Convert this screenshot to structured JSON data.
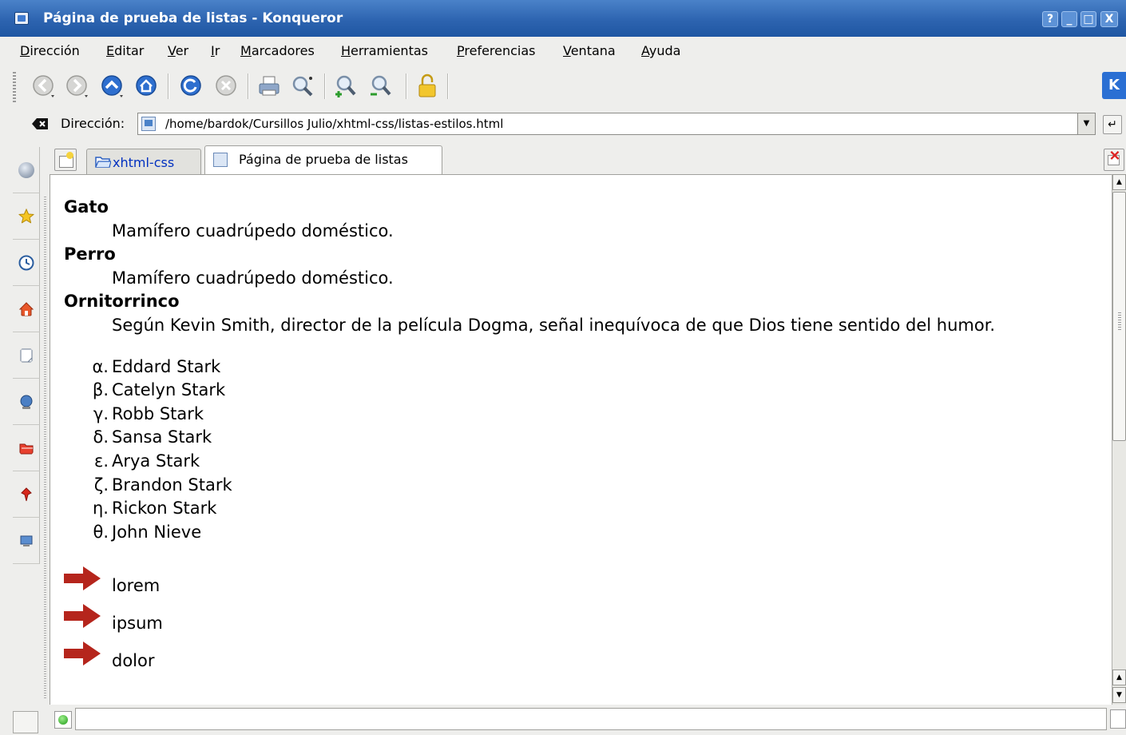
{
  "window": {
    "title": "Página de prueba de listas - Konqueror",
    "controls": [
      "?",
      "_",
      "□",
      "X"
    ]
  },
  "menubar": [
    "Dirección",
    "Editar",
    "Ver",
    "Ir",
    "Marcadores",
    "Herramientas",
    "Preferencias",
    "Ventana",
    "Ayuda"
  ],
  "toolbar": {
    "icons": [
      "back-icon",
      "forward-icon",
      "up-icon",
      "home-icon",
      "reload-icon",
      "stop-icon",
      "print-icon",
      "find-icon",
      "zoom-in-icon",
      "zoom-out-icon",
      "lock-icon"
    ],
    "logo": "K"
  },
  "location": {
    "label": "Dirección:",
    "url": "/home/bardok/Cursillos Julio/xhtml-css/listas-estilos.html"
  },
  "tabs": [
    {
      "label": "xhtml-css",
      "active": false
    },
    {
      "label": "Página de prueba de listas",
      "active": true
    }
  ],
  "sidebar": {
    "buttons": [
      "konqueror-icon",
      "bookmarks-star-icon",
      "history-icon",
      "home-folder-icon",
      "notes-icon",
      "network-icon",
      "folder-icon",
      "services-pin-icon",
      "devices-icon"
    ]
  },
  "content": {
    "definitions": [
      {
        "term": "Gato",
        "description": "Mamífero cuadrúpedo doméstico."
      },
      {
        "term": "Perro",
        "description": "Mamífero cuadrúpedo doméstico."
      },
      {
        "term": "Ornitorrinco",
        "description": "Según Kevin Smith, director de la película Dogma, señal inequívoca de que Dios tiene sentido del humor."
      }
    ],
    "greek_list": [
      {
        "marker": "α.",
        "text": "Eddard Stark"
      },
      {
        "marker": "β.",
        "text": "Catelyn Stark"
      },
      {
        "marker": "γ.",
        "text": "Robb Stark"
      },
      {
        "marker": "δ.",
        "text": "Sansa Stark"
      },
      {
        "marker": "ε.",
        "text": "Arya Stark"
      },
      {
        "marker": "ζ.",
        "text": "Brandon Stark"
      },
      {
        "marker": "η.",
        "text": "Rickon Stark"
      },
      {
        "marker": "θ.",
        "text": "John Nieve"
      }
    ],
    "arrow_list": [
      "lorem",
      "ipsum",
      "dolor"
    ],
    "arrow_color": "#b5251c"
  },
  "colors": {
    "titlebar": "#2d64b0",
    "window_bg": "#eeeeec",
    "link": "#0030c0"
  }
}
